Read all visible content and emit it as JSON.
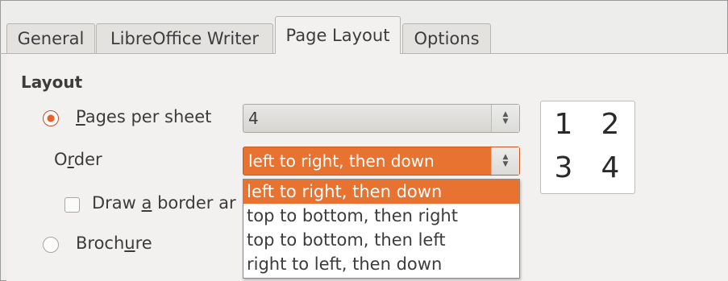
{
  "tabs": [
    {
      "label": "General",
      "active": false
    },
    {
      "label": "LibreOffice Writer",
      "active": false
    },
    {
      "label": "Page Layout",
      "active": true
    },
    {
      "label": "Options",
      "active": false
    }
  ],
  "layout": {
    "section_title": "Layout",
    "pages_per_sheet": {
      "label_prefix": "",
      "accel": "P",
      "label_rest": "ages per sheet",
      "selected": true,
      "value": "4"
    },
    "order": {
      "label_pre": "O",
      "accel": "r",
      "label_post": "der",
      "value": "left to right, then down",
      "options": [
        "left to right, then down",
        "top to bottom, then right",
        "top to bottom, then left",
        "right to left, then down"
      ],
      "highlighted_index": 0
    },
    "draw_border": {
      "label_pre": "Draw ",
      "accel": "a",
      "label_post": " border ar",
      "checked": false
    },
    "brochure": {
      "label_pre": "Broch",
      "accel": "u",
      "label_post": "re",
      "selected": false
    }
  },
  "preview": {
    "pages": [
      "1",
      "2",
      "3",
      "4"
    ]
  },
  "colors": {
    "accent": "#e8722f",
    "panel": "#f2f1f0"
  }
}
